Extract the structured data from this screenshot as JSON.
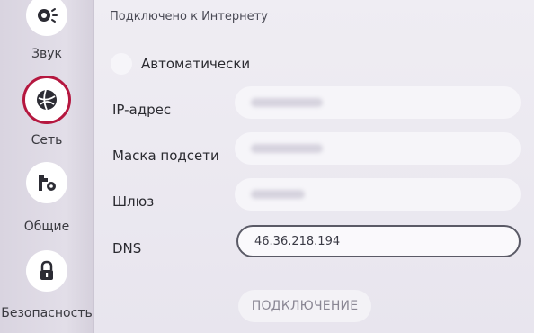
{
  "sidebar": {
    "items": [
      {
        "label": "Звук",
        "icon": "sound-icon"
      },
      {
        "label": "Сеть",
        "icon": "network-globe-icon",
        "active": true
      },
      {
        "label": "Общие",
        "icon": "tools-icon"
      },
      {
        "label": "Безопасность",
        "icon": "lock-icon"
      }
    ],
    "active_color": "#b5173f"
  },
  "main": {
    "status": "Подключено к Интернету",
    "auto_label": "Автоматически",
    "fields": {
      "ip_label": "IP-адрес",
      "mask_label": "Маска подсети",
      "gateway_label": "Шлюз",
      "dns_label": "DNS",
      "dns_value": "46.36.218.194"
    },
    "connect_label": "ПОДКЛЮЧЕНИЕ"
  }
}
